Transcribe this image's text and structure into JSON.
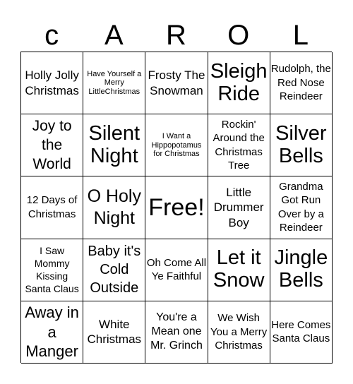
{
  "header": {
    "letters": [
      "c",
      "A",
      "R",
      "O",
      "L"
    ]
  },
  "board": {
    "rows": [
      [
        "Holly Jolly Christmas",
        "Have Yourself a Merry LittleChristmas",
        "Frosty The Snowman",
        "Sleigh Ride",
        "Rudolph, the Red Nose Reindeer"
      ],
      [
        "Joy to the World",
        "Silent Night",
        "I Want a Hippopotamus for Christmas",
        "Rockin' Around the Christmas Tree",
        "Silver Bells"
      ],
      [
        "12 Days of Christmas",
        "O Holy Night",
        "Free!",
        "Little Drummer Boy",
        "Grandma Got Run Over by a Reindeer"
      ],
      [
        "I Saw Mommy Kissing Santa Claus",
        "Baby it's Cold Outside",
        "Oh Come All Ye Faithful",
        "Let it Snow",
        "Jingle Bells"
      ],
      [
        "Away in a Manger",
        "White Christmas",
        "You're a Mean one Mr. Grinch",
        "We Wish You a Merry Christmas",
        "Here Comes Santa Claus"
      ]
    ]
  }
}
